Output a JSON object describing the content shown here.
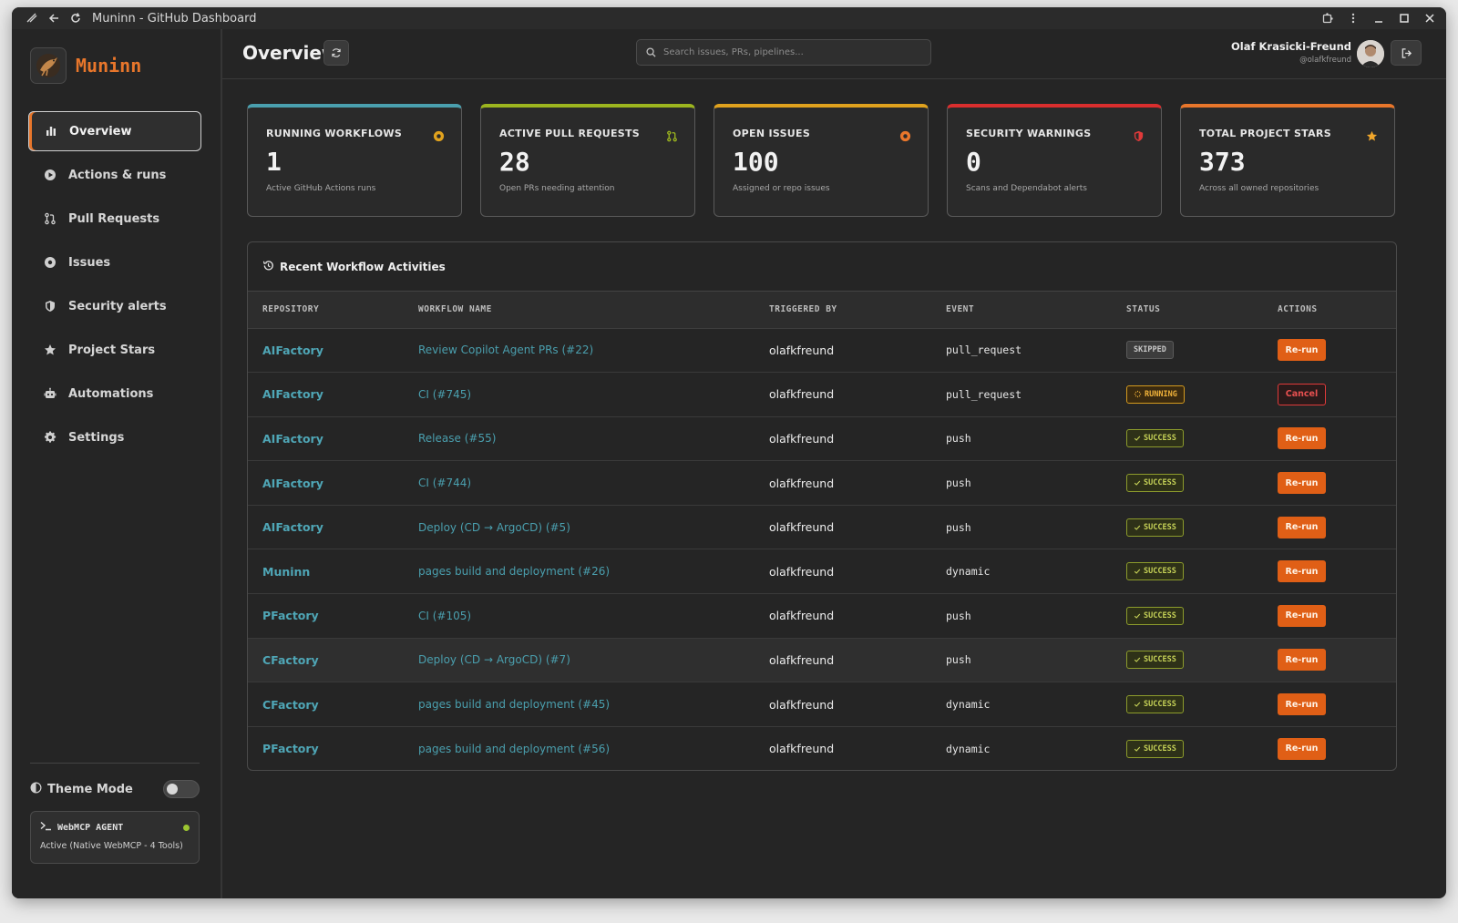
{
  "window": {
    "title": "Muninn - GitHub Dashboard"
  },
  "brand": {
    "name": "Muninn"
  },
  "sidebar": {
    "items": [
      {
        "label": "Overview",
        "icon": "bar-chart-icon"
      },
      {
        "label": "Actions & runs",
        "icon": "play-circle-icon"
      },
      {
        "label": "Pull Requests",
        "icon": "git-pull-request-icon"
      },
      {
        "label": "Issues",
        "icon": "issue-dot-icon"
      },
      {
        "label": "Security alerts",
        "icon": "shield-icon"
      },
      {
        "label": "Project Stars",
        "icon": "star-icon"
      },
      {
        "label": "Automations",
        "icon": "robot-icon"
      },
      {
        "label": "Settings",
        "icon": "gear-icon"
      }
    ],
    "theme_label": "Theme Mode",
    "agent": {
      "title": "WebMCP AGENT",
      "status": "Active (Native WebMCP - 4 Tools)"
    }
  },
  "header": {
    "title": "Overview",
    "search_placeholder": "Search issues, PRs, pipelines...",
    "user_name": "Olaf Krasicki-Freund",
    "user_handle": "@olafkfreund"
  },
  "colors": {
    "accent": "#e8762b",
    "running_workflows": "#4a9fae",
    "active_prs": "#9cb51f",
    "open_issues": "#e0a21e",
    "security": "#d92e2e",
    "stars": "#e8762b"
  },
  "cards": [
    {
      "label": "RUNNING WORKFLOWS",
      "value": "1",
      "sub": "Active GitHub Actions runs"
    },
    {
      "label": "ACTIVE PULL REQUESTS",
      "value": "28",
      "sub": "Open PRs needing attention"
    },
    {
      "label": "OPEN ISSUES",
      "value": "100",
      "sub": "Assigned or repo issues"
    },
    {
      "label": "SECURITY WARNINGS",
      "value": "0",
      "sub": "Scans and Dependabot alerts"
    },
    {
      "label": "TOTAL PROJECT STARS",
      "value": "373",
      "sub": "Across all owned repositories"
    }
  ],
  "activity": {
    "title": "Recent Workflow Activities",
    "columns": [
      "REPOSITORY",
      "WORKFLOW NAME",
      "TRIGGERED BY",
      "EVENT",
      "STATUS",
      "ACTIONS"
    ],
    "rows": [
      {
        "repo": "AIFactory",
        "workflow": "Review Copilot Agent PRs (#22)",
        "by": "olafkfreund",
        "event": "pull_request",
        "status": "SKIPPED",
        "action": "Re-run"
      },
      {
        "repo": "AIFactory",
        "workflow": "CI (#745)",
        "by": "olafkfreund",
        "event": "pull_request",
        "status": "RUNNING",
        "action": "Cancel"
      },
      {
        "repo": "AIFactory",
        "workflow": "Release (#55)",
        "by": "olafkfreund",
        "event": "push",
        "status": "SUCCESS",
        "action": "Re-run"
      },
      {
        "repo": "AIFactory",
        "workflow": "CI (#744)",
        "by": "olafkfreund",
        "event": "push",
        "status": "SUCCESS",
        "action": "Re-run"
      },
      {
        "repo": "AIFactory",
        "workflow": "Deploy (CD → ArgoCD) (#5)",
        "by": "olafkfreund",
        "event": "push",
        "status": "SUCCESS",
        "action": "Re-run"
      },
      {
        "repo": "Muninn",
        "workflow": "pages build and deployment (#26)",
        "by": "olafkfreund",
        "event": "dynamic",
        "status": "SUCCESS",
        "action": "Re-run"
      },
      {
        "repo": "PFactory",
        "workflow": "CI (#105)",
        "by": "olafkfreund",
        "event": "push",
        "status": "SUCCESS",
        "action": "Re-run"
      },
      {
        "repo": "CFactory",
        "workflow": "Deploy (CD → ArgoCD) (#7)",
        "by": "olafkfreund",
        "event": "push",
        "status": "SUCCESS",
        "action": "Re-run"
      },
      {
        "repo": "CFactory",
        "workflow": "pages build and deployment (#45)",
        "by": "olafkfreund",
        "event": "dynamic",
        "status": "SUCCESS",
        "action": "Re-run"
      },
      {
        "repo": "PFactory",
        "workflow": "pages build and deployment (#56)",
        "by": "olafkfreund",
        "event": "dynamic",
        "status": "SUCCESS",
        "action": "Re-run"
      }
    ]
  }
}
